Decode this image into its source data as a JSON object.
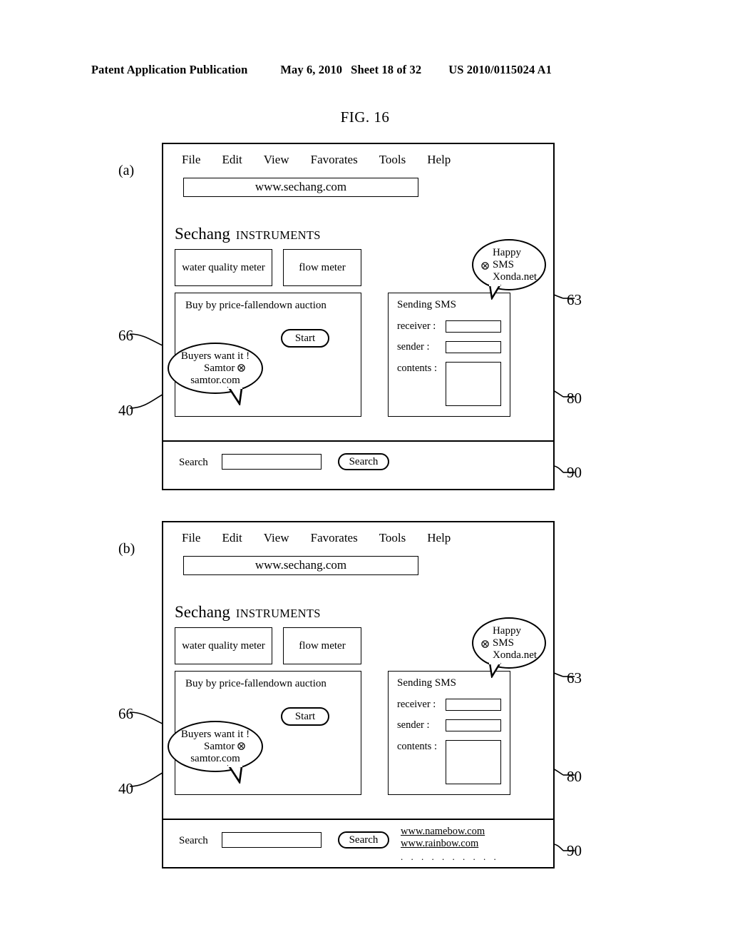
{
  "page": {
    "header": {
      "publication": "Patent Application Publication",
      "date": "May 6, 2010",
      "sheet": "Sheet 18 of 32",
      "number": "US 2010/0115024 A1"
    },
    "figure_title": "FIG. 16"
  },
  "figures": [
    {
      "letter": "(a)",
      "browser": {
        "menu": [
          "File",
          "Edit",
          "View",
          "Favorates",
          "Tools",
          "Help"
        ],
        "url": "www.sechang.com"
      },
      "site": {
        "brand": "Sechang",
        "brand_sub": "INSTRUMENTS",
        "meter_buttons": [
          "water quality meter",
          "flow meter"
        ],
        "auction": {
          "title": "Buy by price-fallendown auction",
          "start_label": "Start"
        },
        "sms": {
          "title": "Sending SMS",
          "fields": [
            {
              "label": "receiver :",
              "value": ""
            },
            {
              "label": "sender   :",
              "value": ""
            },
            {
              "label": "contents :",
              "value": ""
            }
          ]
        }
      },
      "search": {
        "label": "Search",
        "value": "",
        "button_label": "Search",
        "results": [],
        "results_more": ""
      },
      "bubbles": {
        "sms_ad": {
          "icon": "circled-x-icon",
          "lines": [
            "Happy",
            "SMS",
            "Xonda.net"
          ]
        },
        "auction_ad": {
          "icon": "circled-x-icon",
          "line1": "Buyers want it !",
          "line2": "Samtor",
          "line3": "samtor.com"
        }
      },
      "refs": {
        "sms_ad": "63",
        "sms_panel": "80",
        "search_strip": "90",
        "auction_ad": "66",
        "auction_panel": "40"
      }
    },
    {
      "letter": "(b)",
      "browser": {
        "menu": [
          "File",
          "Edit",
          "View",
          "Favorates",
          "Tools",
          "Help"
        ],
        "url": "www.sechang.com"
      },
      "site": {
        "brand": "Sechang",
        "brand_sub": "INSTRUMENTS",
        "meter_buttons": [
          "water quality meter",
          "flow meter"
        ],
        "auction": {
          "title": "Buy by price-fallendown auction",
          "start_label": "Start"
        },
        "sms": {
          "title": "Sending SMS",
          "fields": [
            {
              "label": "receiver :",
              "value": ""
            },
            {
              "label": "sender   :",
              "value": ""
            },
            {
              "label": "contents :",
              "value": ""
            }
          ]
        }
      },
      "search": {
        "label": "Search",
        "value": "",
        "button_label": "Search",
        "results": [
          "www.namebow.com",
          "www.rainbow.com"
        ],
        "results_more": ". . . . . . . . . ."
      },
      "bubbles": {
        "sms_ad": {
          "icon": "circled-x-icon",
          "lines": [
            "Happy",
            "SMS",
            "Xonda.net"
          ]
        },
        "auction_ad": {
          "icon": "circled-x-icon",
          "line1": "Buyers want it !",
          "line2": "Samtor",
          "line3": "samtor.com"
        }
      },
      "refs": {
        "sms_ad": "63",
        "sms_panel": "80",
        "search_strip": "90",
        "auction_ad": "66",
        "auction_panel": "40"
      }
    }
  ]
}
